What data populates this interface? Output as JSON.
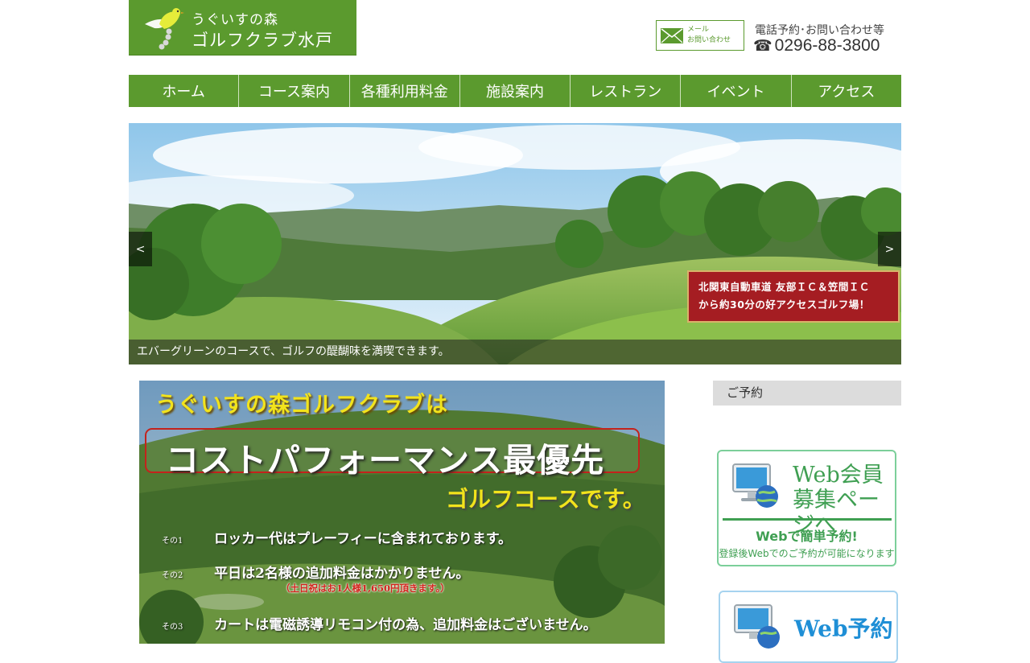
{
  "header": {
    "logo_line1": "うぐいすの森",
    "logo_line2": "ゴルフクラブ水戸",
    "mail_line1": "メール",
    "mail_line2": "お問い合わせ",
    "contact_label": "電話予約･お問い合わせ等",
    "phone_icon": "☎",
    "phone_number": "0296-88-3800"
  },
  "nav": {
    "items": [
      {
        "label": "ホーム"
      },
      {
        "label": "コース案内"
      },
      {
        "label": "各種利用料金"
      },
      {
        "label": "施設案内"
      },
      {
        "label": "レストラン"
      },
      {
        "label": "イベント"
      },
      {
        "label": "アクセス"
      }
    ]
  },
  "hero": {
    "prev_label": "<",
    "next_label": ">",
    "badge_line1": "北関東自動車道 友部ＩＣ＆笠間ＩＣ",
    "badge_line2": "から約30分の好アクセスゴルフ場！",
    "caption": "エバーグリーンのコースで、ゴルフの醍醐味を満喫できます。"
  },
  "banner": {
    "headline": "うぐいすの森ゴルフクラブは",
    "boxed": "コストパフォーマンス最優先",
    "sub": "ゴルフコースです。",
    "items": [
      {
        "no": "その1",
        "text": "ロッカー代はプレーフィーに含まれております。"
      },
      {
        "no": "その2",
        "text": "平日は2名様の追加料金はかかりません。"
      },
      {
        "no": "その3",
        "text": "カートは電磁誘導リモコン付の為、追加料金はございません。"
      }
    ],
    "note": "（土日祝はお1人様1,650円頂きます。）"
  },
  "sidebar": {
    "heading": "ご予約",
    "member_title_line1": "Web会員",
    "member_title_line2": "募集ページへ",
    "member_cta": "Webで簡単予約!",
    "member_note": "登録後Webでのご予約が可能になります",
    "booking_title": "Web予約"
  },
  "colors": {
    "brand_green": "#5b9a2e",
    "card_green": "#3f9f52",
    "accent_red": "#a51d22",
    "accent_yellow": "#f2e31c",
    "web_blue": "#1f8fd6"
  },
  "icons": [
    "bird-logo-icon",
    "mail-icon",
    "phone-icon",
    "monitor-globe-icon"
  ]
}
